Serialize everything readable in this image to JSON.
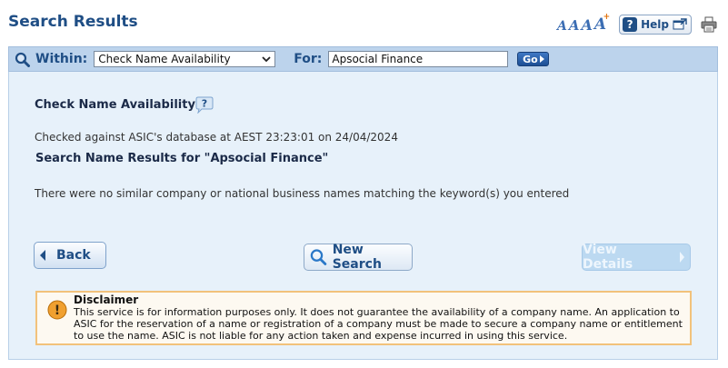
{
  "header": {
    "title": "Search Results",
    "font_size_glyph": "A",
    "font_increase_glyph": "+",
    "help_label": "Help",
    "help_symbol": "?",
    "icons": [
      "font-size-icon",
      "help-icon",
      "popup-icon",
      "print-icon"
    ]
  },
  "search_bar": {
    "within_label": "Within:",
    "within_selected": "Check Name Availability",
    "for_label": "For:",
    "for_value": "Apsocial Finance",
    "go_label": "Go"
  },
  "main": {
    "section_title": "Check Name Availability",
    "help_bubble_symbol": "?",
    "checked_text": "Checked against ASIC's database at AEST 23:23:01 on 24/04/2024",
    "results_title": "Search Name Results for \"Apsocial Finance\"",
    "no_results_text": "There were no similar company or national business names matching the keyword(s) you entered"
  },
  "buttons": {
    "back": "Back",
    "new_search": "New Search",
    "view_details": "View Details"
  },
  "disclaimer": {
    "title": "Disclaimer",
    "text": "This service is for information purposes only. It does not guarantee the availability of a company name. An application to ASIC for the reservation of a name or registration of a company must be made to secure a company name or entitlement to use the name. ASIC is not liable for any action taken and expense incurred in using this service.",
    "icon_symbol": "!"
  },
  "colors": {
    "brand_blue": "#1f4e85",
    "search_bar_bg": "#bcd3ec",
    "panel_bg": "#e7f1fa",
    "disclaimer_border": "#f2c27b",
    "warning": "#f0a030"
  }
}
